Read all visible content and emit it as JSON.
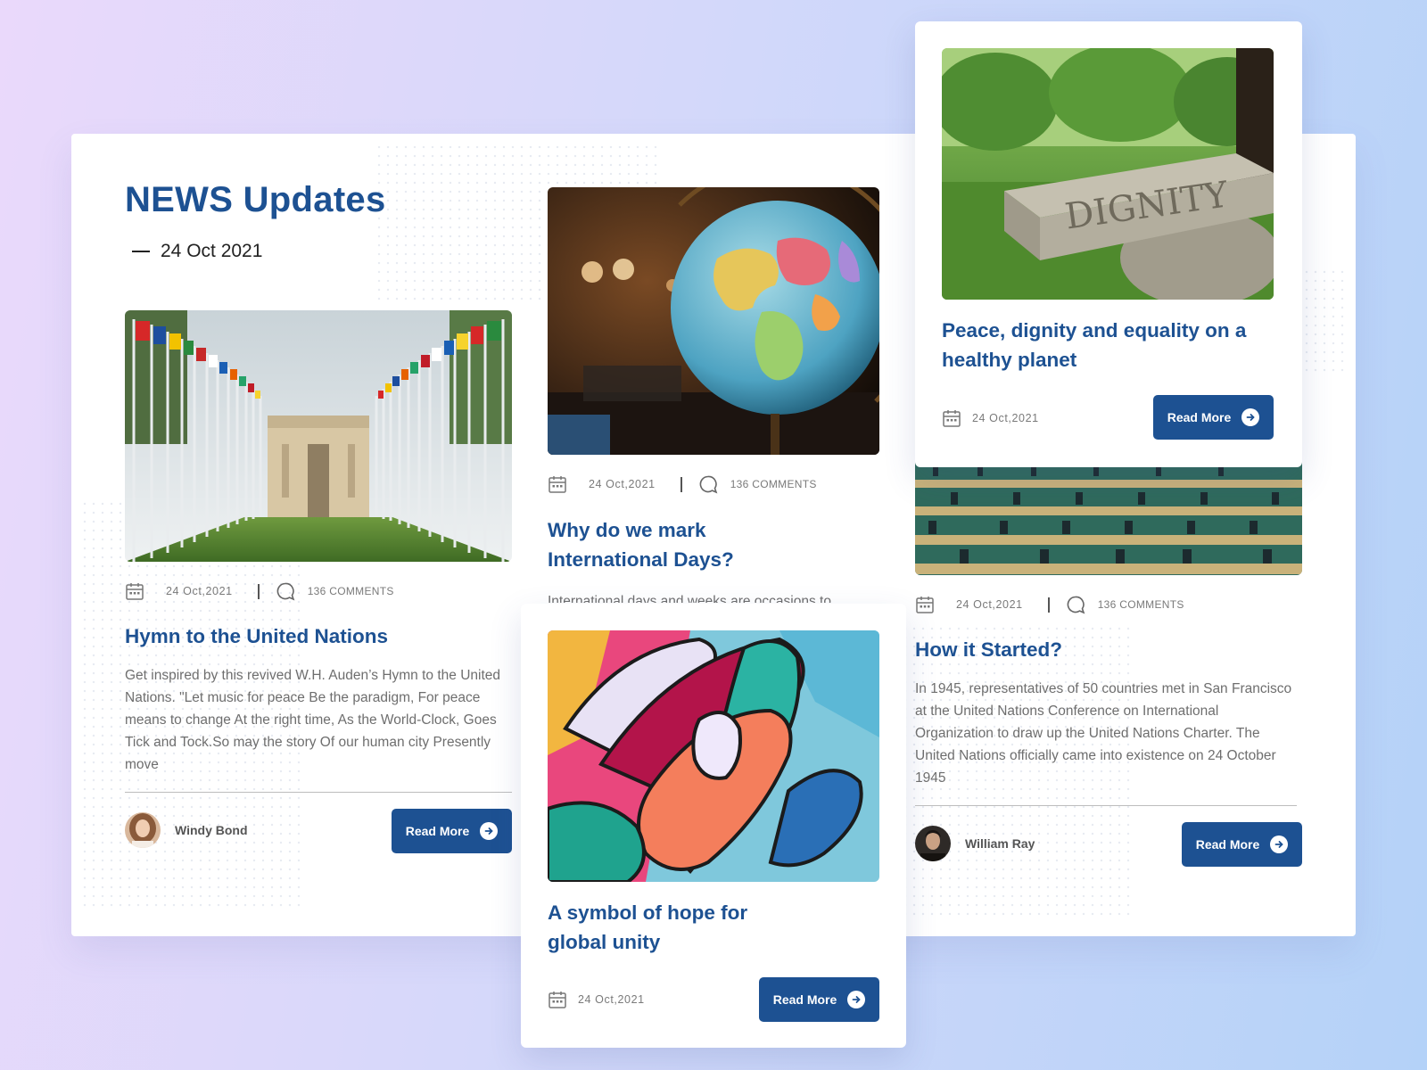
{
  "header": {
    "title": "NEWS Updates",
    "date": "24 Oct 2021"
  },
  "cards": {
    "hymn": {
      "date": "24 Oct,2021",
      "comments": "136 COMMENTS",
      "title": "Hymn to the United Nations",
      "excerpt": "Get inspired by this revived W.H. Auden’s Hymn to the United Nations. \"Let music for peace Be the paradigm, For peace means to change At the right time, As the World-Clock, Goes Tick and Tock.So may the story Of our human city Presently move",
      "author": "Windy Bond",
      "button": "Read More"
    },
    "intl_days": {
      "date": "24 Oct,2021",
      "comments": "136 COMMENTS",
      "title": "Why do we mark International Days?",
      "excerpt": "International days and weeks are occasions to"
    },
    "hope": {
      "title": "A symbol of hope for global unity",
      "date": "24 Oct,2021",
      "button": "Read More"
    },
    "peace": {
      "title": "Peace, dignity and equality on a healthy planet",
      "date": "24 Oct,2021",
      "button": "Read More",
      "stone_text": "DIGNITY"
    },
    "started": {
      "date": "24 Oct,2021",
      "comments": "136 COMMENTS",
      "title": "How it Started?",
      "excerpt": "In 1945, representatives of 50 countries met in San Francisco at the United Nations Conference on International Organization to draw up the United Nations Charter. The United Nations officially came into existence on 24 October 1945",
      "author": "William Ray",
      "button": "Read More"
    }
  },
  "icons": [
    "calendar-icon",
    "comment-icon",
    "arrow-right-icon"
  ],
  "colors": {
    "accent": "#1d5192",
    "body_text": "#6e6e6e",
    "background_left": "#ead9fb",
    "background_right": "#b4d2f8"
  }
}
